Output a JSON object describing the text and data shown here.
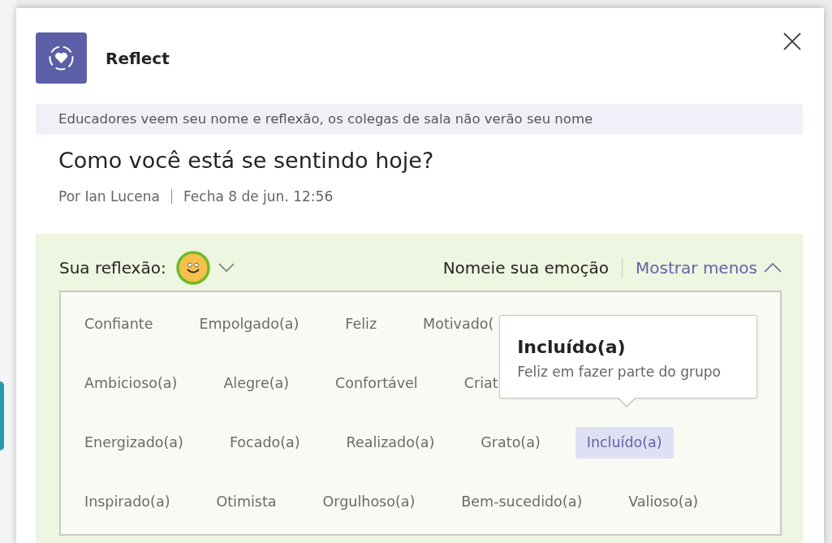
{
  "dialog": {
    "app_name": "Reflect",
    "notice": "Educadores veem seu nome e reflexão, os colegas de sala não verão seu nome",
    "question": "Como você está se sentindo hoje?",
    "author": "Por Ian Lucena",
    "closing": "Fecha 8 de jun. 12:56"
  },
  "reflection": {
    "label": "Sua reflexão:",
    "name_prompt": "Nomeie sua emoção",
    "toggle_label": "Mostrar menos",
    "expanded": true
  },
  "emotion_rows": [
    {
      "items": [
        {
          "label": "Confiante",
          "selected": false
        },
        {
          "label": "Empolgado(a)",
          "selected": false
        },
        {
          "label": "Feliz",
          "selected": false
        },
        {
          "label": "Motivado(",
          "selected": false
        }
      ]
    },
    {
      "items": [
        {
          "label": "Ambicioso(a)",
          "selected": false
        },
        {
          "label": "Alegre(a)",
          "selected": false
        },
        {
          "label": "Confortável",
          "selected": false
        },
        {
          "label": "Criat",
          "selected": false
        }
      ]
    },
    {
      "items": [
        {
          "label": "Energizado(a)",
          "selected": false
        },
        {
          "label": "Focado(a)",
          "selected": false
        },
        {
          "label": "Realizado(a)",
          "selected": false
        },
        {
          "label": "Grato(a)",
          "selected": false
        },
        {
          "label": "Incluído(a)",
          "selected": true
        }
      ]
    },
    {
      "items": [
        {
          "label": "Inspirado(a)",
          "selected": false
        },
        {
          "label": "Otimista",
          "selected": false
        },
        {
          "label": "Orgulhoso(a)",
          "selected": false
        },
        {
          "label": "Bem-sucedido(a)",
          "selected": false
        },
        {
          "label": "Valioso(a)",
          "selected": false
        }
      ]
    }
  ],
  "tooltip": {
    "title": "Incluído(a)",
    "description": "Feliz em fazer parte do grupo"
  }
}
